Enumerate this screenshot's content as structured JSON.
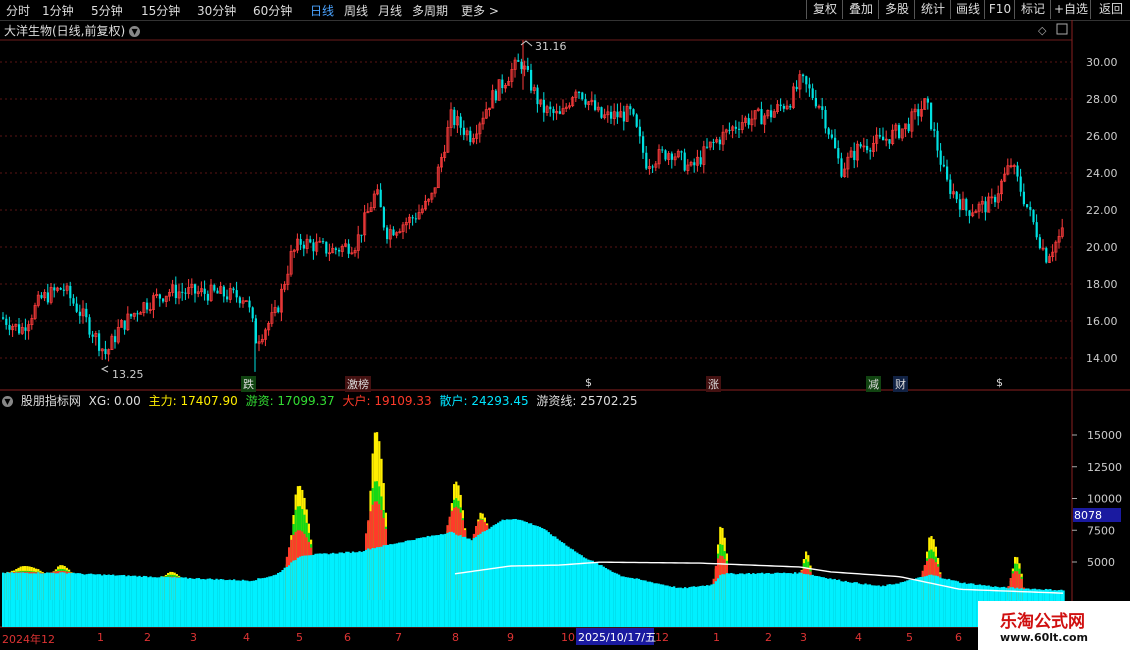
{
  "toolbar": {
    "periods": [
      "分时",
      "1分钟",
      "5分钟",
      "15分钟",
      "30分钟",
      "60分钟",
      "日线",
      "周线",
      "月线",
      "多周期",
      "更多 >"
    ],
    "active_period": "日线",
    "right_buttons": [
      "复权",
      "叠加",
      "多股",
      "统计",
      "画线",
      "F10",
      "标记",
      "+自选",
      "返回"
    ]
  },
  "chart": {
    "title": "大洋生物(日线,前复权)",
    "high_label": "31.16",
    "low_label": "13.25",
    "price_ticks": [
      "30.00",
      "28.00",
      "26.00",
      "24.00",
      "22.00",
      "20.00",
      "18.00",
      "16.00",
      "14.00"
    ],
    "markers": [
      {
        "text": "跌",
        "color": "#2bd12b"
      },
      {
        "text": "激榜",
        "color": "#e24040"
      },
      {
        "text": "$",
        "color": "#e24040"
      },
      {
        "text": "涨",
        "color": "#e24040"
      },
      {
        "text": "减",
        "color": "#2bd12b"
      },
      {
        "text": "财",
        "color": "#4aa3ff"
      },
      {
        "text": "$",
        "color": "#e24040"
      }
    ]
  },
  "indicator": {
    "name": "股朋指标网",
    "xg": "XG: 0.00",
    "main": "主力: 17407.90",
    "hot": "游资: 17099.37",
    "big": "大户: 19109.33",
    "retail": "散户: 24293.45",
    "line": "游资线: 25702.25",
    "ticks": [
      "15000",
      "12500",
      "10000",
      "7500",
      "5000"
    ],
    "current_value": "8078"
  },
  "xaxis": {
    "labels": [
      "2024年12",
      "1",
      "2",
      "3",
      "4",
      "5",
      "6",
      "7",
      "8",
      "9",
      "10",
      "12",
      "1",
      "2",
      "3",
      "4",
      "5",
      "6"
    ],
    "cursor_date": "2025/10/17/五"
  },
  "watermark": {
    "title": "乐淘公式网",
    "url": "www.60lt.com"
  },
  "colors": {
    "up": "#ff3c3c",
    "down": "#00e0e0",
    "yellow": "#ffee00",
    "green": "#14d914",
    "red": "#ff3a2a",
    "cyan": "#00f0ff"
  }
}
